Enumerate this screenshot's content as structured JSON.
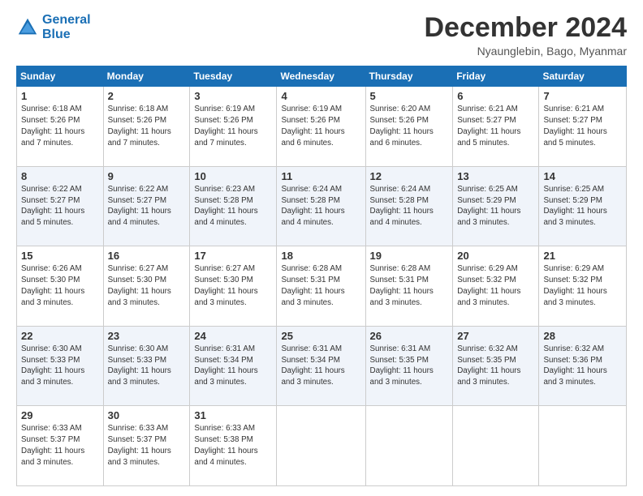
{
  "logo": {
    "line1": "General",
    "line2": "Blue"
  },
  "header": {
    "month": "December 2024",
    "location": "Nyaunglebin, Bago, Myanmar"
  },
  "weekdays": [
    "Sunday",
    "Monday",
    "Tuesday",
    "Wednesday",
    "Thursday",
    "Friday",
    "Saturday"
  ],
  "weeks": [
    [
      {
        "day": "1",
        "info": "Sunrise: 6:18 AM\nSunset: 5:26 PM\nDaylight: 11 hours\nand 7 minutes."
      },
      {
        "day": "2",
        "info": "Sunrise: 6:18 AM\nSunset: 5:26 PM\nDaylight: 11 hours\nand 7 minutes."
      },
      {
        "day": "3",
        "info": "Sunrise: 6:19 AM\nSunset: 5:26 PM\nDaylight: 11 hours\nand 7 minutes."
      },
      {
        "day": "4",
        "info": "Sunrise: 6:19 AM\nSunset: 5:26 PM\nDaylight: 11 hours\nand 6 minutes."
      },
      {
        "day": "5",
        "info": "Sunrise: 6:20 AM\nSunset: 5:26 PM\nDaylight: 11 hours\nand 6 minutes."
      },
      {
        "day": "6",
        "info": "Sunrise: 6:21 AM\nSunset: 5:27 PM\nDaylight: 11 hours\nand 5 minutes."
      },
      {
        "day": "7",
        "info": "Sunrise: 6:21 AM\nSunset: 5:27 PM\nDaylight: 11 hours\nand 5 minutes."
      }
    ],
    [
      {
        "day": "8",
        "info": "Sunrise: 6:22 AM\nSunset: 5:27 PM\nDaylight: 11 hours\nand 5 minutes."
      },
      {
        "day": "9",
        "info": "Sunrise: 6:22 AM\nSunset: 5:27 PM\nDaylight: 11 hours\nand 4 minutes."
      },
      {
        "day": "10",
        "info": "Sunrise: 6:23 AM\nSunset: 5:28 PM\nDaylight: 11 hours\nand 4 minutes."
      },
      {
        "day": "11",
        "info": "Sunrise: 6:24 AM\nSunset: 5:28 PM\nDaylight: 11 hours\nand 4 minutes."
      },
      {
        "day": "12",
        "info": "Sunrise: 6:24 AM\nSunset: 5:28 PM\nDaylight: 11 hours\nand 4 minutes."
      },
      {
        "day": "13",
        "info": "Sunrise: 6:25 AM\nSunset: 5:29 PM\nDaylight: 11 hours\nand 3 minutes."
      },
      {
        "day": "14",
        "info": "Sunrise: 6:25 AM\nSunset: 5:29 PM\nDaylight: 11 hours\nand 3 minutes."
      }
    ],
    [
      {
        "day": "15",
        "info": "Sunrise: 6:26 AM\nSunset: 5:30 PM\nDaylight: 11 hours\nand 3 minutes."
      },
      {
        "day": "16",
        "info": "Sunrise: 6:27 AM\nSunset: 5:30 PM\nDaylight: 11 hours\nand 3 minutes."
      },
      {
        "day": "17",
        "info": "Sunrise: 6:27 AM\nSunset: 5:30 PM\nDaylight: 11 hours\nand 3 minutes."
      },
      {
        "day": "18",
        "info": "Sunrise: 6:28 AM\nSunset: 5:31 PM\nDaylight: 11 hours\nand 3 minutes."
      },
      {
        "day": "19",
        "info": "Sunrise: 6:28 AM\nSunset: 5:31 PM\nDaylight: 11 hours\nand 3 minutes."
      },
      {
        "day": "20",
        "info": "Sunrise: 6:29 AM\nSunset: 5:32 PM\nDaylight: 11 hours\nand 3 minutes."
      },
      {
        "day": "21",
        "info": "Sunrise: 6:29 AM\nSunset: 5:32 PM\nDaylight: 11 hours\nand 3 minutes."
      }
    ],
    [
      {
        "day": "22",
        "info": "Sunrise: 6:30 AM\nSunset: 5:33 PM\nDaylight: 11 hours\nand 3 minutes."
      },
      {
        "day": "23",
        "info": "Sunrise: 6:30 AM\nSunset: 5:33 PM\nDaylight: 11 hours\nand 3 minutes."
      },
      {
        "day": "24",
        "info": "Sunrise: 6:31 AM\nSunset: 5:34 PM\nDaylight: 11 hours\nand 3 minutes."
      },
      {
        "day": "25",
        "info": "Sunrise: 6:31 AM\nSunset: 5:34 PM\nDaylight: 11 hours\nand 3 minutes."
      },
      {
        "day": "26",
        "info": "Sunrise: 6:31 AM\nSunset: 5:35 PM\nDaylight: 11 hours\nand 3 minutes."
      },
      {
        "day": "27",
        "info": "Sunrise: 6:32 AM\nSunset: 5:35 PM\nDaylight: 11 hours\nand 3 minutes."
      },
      {
        "day": "28",
        "info": "Sunrise: 6:32 AM\nSunset: 5:36 PM\nDaylight: 11 hours\nand 3 minutes."
      }
    ],
    [
      {
        "day": "29",
        "info": "Sunrise: 6:33 AM\nSunset: 5:37 PM\nDaylight: 11 hours\nand 3 minutes."
      },
      {
        "day": "30",
        "info": "Sunrise: 6:33 AM\nSunset: 5:37 PM\nDaylight: 11 hours\nand 3 minutes."
      },
      {
        "day": "31",
        "info": "Sunrise: 6:33 AM\nSunset: 5:38 PM\nDaylight: 11 hours\nand 4 minutes."
      },
      {
        "day": "",
        "info": ""
      },
      {
        "day": "",
        "info": ""
      },
      {
        "day": "",
        "info": ""
      },
      {
        "day": "",
        "info": ""
      }
    ]
  ]
}
